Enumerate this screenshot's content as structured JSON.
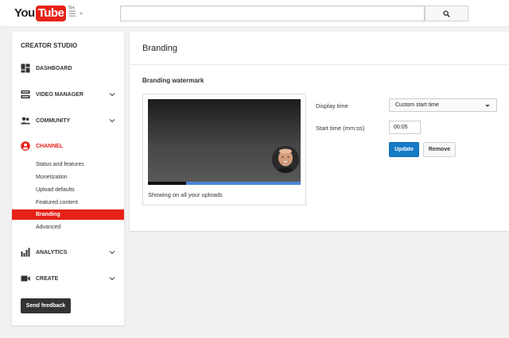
{
  "masthead": {
    "logo_you": "You",
    "logo_tube": "Tube",
    "logo_region": "TH",
    "search_placeholder": "",
    "search_value": ""
  },
  "sidebar": {
    "title": "CREATOR STUDIO",
    "items": [
      {
        "label": "DASHBOARD",
        "icon": "dashboard-icon",
        "expandable": false,
        "active": false
      },
      {
        "label": "VIDEO MANAGER",
        "icon": "video-manager-icon",
        "expandable": true,
        "active": false
      },
      {
        "label": "COMMUNITY",
        "icon": "community-icon",
        "expandable": true,
        "active": false
      },
      {
        "label": "CHANNEL",
        "icon": "channel-icon",
        "expandable": false,
        "active": true
      },
      {
        "label": "ANALYTICS",
        "icon": "analytics-icon",
        "expandable": true,
        "active": false
      },
      {
        "label": "CREATE",
        "icon": "create-icon",
        "expandable": true,
        "active": false
      }
    ],
    "channel_subitems": [
      {
        "label": "Status and features",
        "active": false
      },
      {
        "label": "Monetization",
        "active": false
      },
      {
        "label": "Upload defaults",
        "active": false
      },
      {
        "label": "Featured content",
        "active": false
      },
      {
        "label": "Branding",
        "active": true
      },
      {
        "label": "Advanced",
        "active": false
      }
    ],
    "feedback_label": "Send feedback"
  },
  "main": {
    "title": "Branding",
    "section_title": "Branding watermark",
    "preview_caption": "Showing on all your uploads",
    "preview_progress": 0.25,
    "display_time_label": "Display time",
    "display_time_value": "Custom start time",
    "start_time_label": "Start time (mm:ss)",
    "start_time_value": "00:05",
    "update_label": "Update",
    "remove_label": "Remove"
  },
  "colors": {
    "brand_red": "#e62117",
    "active_channel": "#e62117",
    "primary_blue": "#167ac6",
    "progress_blue": "#4d86d6"
  }
}
